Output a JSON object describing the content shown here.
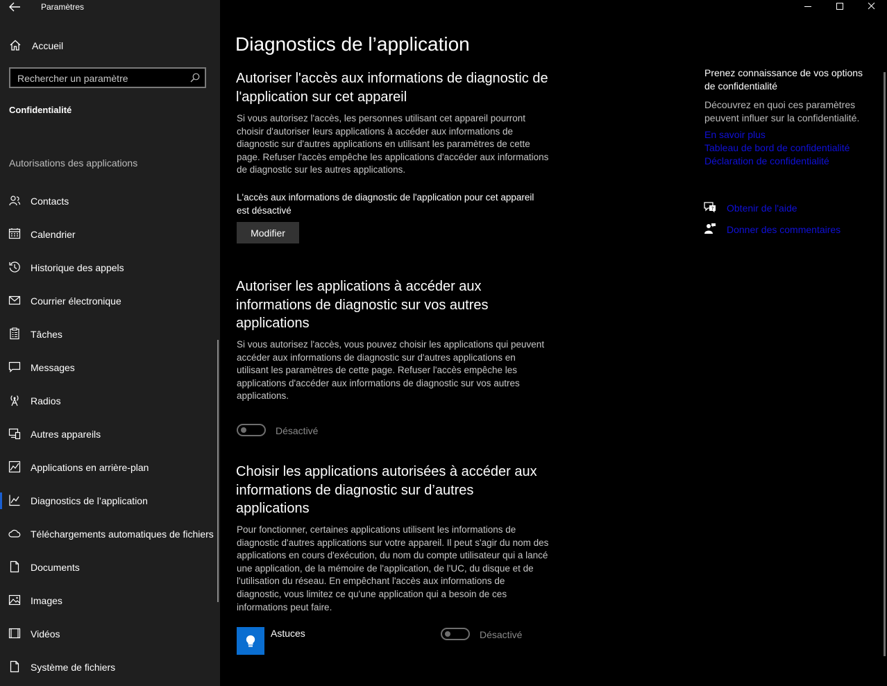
{
  "window": {
    "title": "Paramètres"
  },
  "sidebar": {
    "home_label": "Accueil",
    "search_placeholder": "Rechercher un paramètre",
    "section_title": "Confidentialité",
    "group_title": "Autorisations des applications",
    "items": [
      {
        "label": "Contacts",
        "icon": "contacts-icon"
      },
      {
        "label": "Calendrier",
        "icon": "calendar-icon"
      },
      {
        "label": "Historique des appels",
        "icon": "call-history-icon"
      },
      {
        "label": "Courrier électronique",
        "icon": "mail-icon"
      },
      {
        "label": "Tâches",
        "icon": "tasks-icon"
      },
      {
        "label": "Messages",
        "icon": "messages-icon"
      },
      {
        "label": "Radios",
        "icon": "radio-icon"
      },
      {
        "label": "Autres appareils",
        "icon": "devices-icon"
      },
      {
        "label": "Applications en arrière-plan",
        "icon": "background-apps-icon"
      },
      {
        "label": "Diagnostics de l’application",
        "icon": "diagnostics-icon",
        "active": true
      },
      {
        "label": "Téléchargements automatiques de fichiers",
        "icon": "cloud-icon"
      },
      {
        "label": "Documents",
        "icon": "document-icon"
      },
      {
        "label": "Images",
        "icon": "image-icon"
      },
      {
        "label": "Vidéos",
        "icon": "video-icon"
      },
      {
        "label": "Système de fichiers",
        "icon": "file-system-icon"
      }
    ]
  },
  "main": {
    "page_title": "Diagnostics de l’application",
    "section1": {
      "heading": "Autoriser l'accès aux informations de diagnostic de l'application sur cet appareil",
      "description": "Si vous autorisez l'accès, les personnes utilisant cet appareil pourront choisir d'autoriser leurs applications à accéder aux informations de diagnostic sur d'autres applications en utilisant les paramètres de cette page. Refuser l'accès empêche les applications d'accéder aux informations de diagnostic sur les autres applications.",
      "status": "L'accès aux informations de diagnostic de l'application pour cet appareil est désactivé",
      "button_label": "Modifier"
    },
    "section2": {
      "heading": "Autoriser les applications à accéder aux informations de diagnostic sur vos autres applications",
      "description": "Si vous autorisez l'accès, vous pouvez choisir les applications qui peuvent accéder aux informations de diagnostic sur d'autres applications en utilisant les paramètres de cette page. Refuser l'accès empêche les applications d'accéder aux informations de diagnostic sur vos autres applications.",
      "toggle_label": "Désactivé"
    },
    "section3": {
      "heading": "Choisir les applications autorisées à accéder aux informations de diagnostic sur d’autres applications",
      "description": "Pour fonctionner, certaines applications utilisent les informations de diagnostic d'autres applications sur votre appareil. Il peut s'agir du nom des applications en cours d'exécution, du nom du compte utilisateur qui a lancé une application, de la mémoire de l'application, de l'UC, du disque et de l'utilisation du réseau. En empêchant l'accès aux informations de diagnostic, vous limitez ce qu'une application qui a besoin de ces informations peut faire.",
      "apps": [
        {
          "name": "Astuces",
          "toggle_label": "Désactivé",
          "icon": "lightbulb-icon"
        }
      ]
    }
  },
  "right_panel": {
    "title": "Prenez connaissance de vos options de confidentialité",
    "description": "Découvrez en quoi ces paramètres peuvent influer sur la confidentialité.",
    "links": [
      "En savoir plus",
      "Tableau de bord de confidentialité",
      "Déclaration de confidentialité"
    ],
    "help_label": "Obtenir de l'aide",
    "feedback_label": "Donner des commentaires"
  },
  "colors": {
    "accent": "#1a5fd1",
    "link": "#1010d8",
    "app_tile": "#0a6ed1",
    "sidebar_bg": "#1f1f1f"
  }
}
